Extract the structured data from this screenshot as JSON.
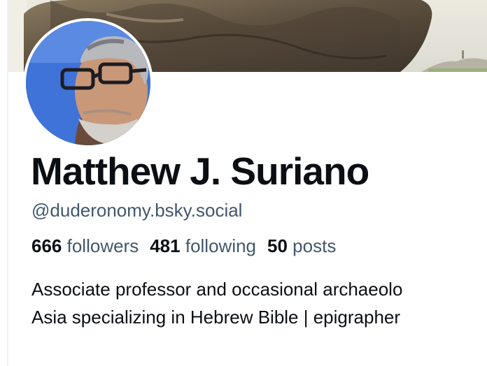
{
  "profile": {
    "display_name": "Matthew J. Suriano",
    "handle": "@duderonomy.bsky.social",
    "bio_lines": [
      "Associate professor and occasional archaeolo",
      "Asia specializing in Hebrew Bible | epigrapher"
    ]
  },
  "stats": {
    "followers": {
      "count": "666",
      "label": "followers"
    },
    "following": {
      "count": "481",
      "label": "following"
    },
    "posts": {
      "count": "50",
      "label": "posts"
    }
  },
  "colors": {
    "name_text": "#0b0f14",
    "secondary_text": "#42576c",
    "avatar_sky": "#3f73d8",
    "banner_sky": "#e4e2d7"
  },
  "images": {
    "banner": "banner-photo",
    "avatar": "avatar-photo"
  }
}
